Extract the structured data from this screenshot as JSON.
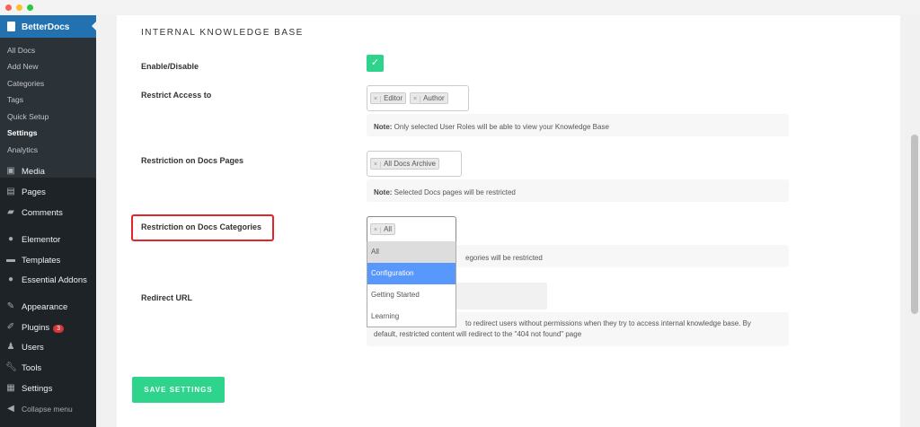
{
  "colors": {
    "accent": "#2271b1",
    "success": "#2ed48c",
    "highlight": "#5897fb",
    "outline": "#e3252b"
  },
  "sidebar": {
    "active": "BetterDocs",
    "submenu": [
      "All Docs",
      "Add New",
      "Categories",
      "Tags",
      "Quick Setup",
      "Settings",
      "Analytics"
    ],
    "current_sub": "Settings",
    "items": [
      {
        "label": "Media",
        "icon": "media-icon"
      },
      {
        "label": "Pages",
        "icon": "pages-icon"
      },
      {
        "label": "Comments",
        "icon": "comments-icon"
      },
      {
        "label": "Elementor",
        "icon": "elementor-icon"
      },
      {
        "label": "Templates",
        "icon": "folder-icon"
      },
      {
        "label": "Essential Addons",
        "icon": "ea-icon"
      },
      {
        "label": "Appearance",
        "icon": "brush-icon"
      },
      {
        "label": "Plugins",
        "icon": "plugin-icon",
        "badge": "3"
      },
      {
        "label": "Users",
        "icon": "user-icon"
      },
      {
        "label": "Tools",
        "icon": "wrench-icon"
      },
      {
        "label": "Settings",
        "icon": "settings-icon"
      },
      {
        "label": "Collapse menu",
        "icon": "collapse-icon"
      }
    ]
  },
  "main": {
    "heading": "INTERNAL KNOWLEDGE BASE",
    "enable_label": "Enable/Disable",
    "enabled": true,
    "restrict_access": {
      "label": "Restrict Access to",
      "tags": [
        "Editor",
        "Author"
      ],
      "note_bold": "Note:",
      "note": " Only selected User Roles will be able to view your Knowledge Base"
    },
    "docs_pages": {
      "label": "Restriction on Docs Pages",
      "tags": [
        "All Docs Archive"
      ],
      "note_bold": "Note:",
      "note": " Selected Docs pages will be restricted"
    },
    "docs_categories": {
      "label": "Restriction on Docs Categories",
      "tags": [
        "All"
      ],
      "note_visible": "egories will be restricted",
      "options": [
        "All",
        "Configuration",
        "Getting Started",
        "Learning"
      ],
      "highlighted": "Configuration"
    },
    "redirect": {
      "label": "Redirect URL",
      "note_line1": "to redirect users without permissions when they try to access internal knowledge base. By",
      "note_line2": "default, restricted content will redirect to the \"404 not found\" page"
    },
    "save": "SAVE SETTINGS"
  }
}
